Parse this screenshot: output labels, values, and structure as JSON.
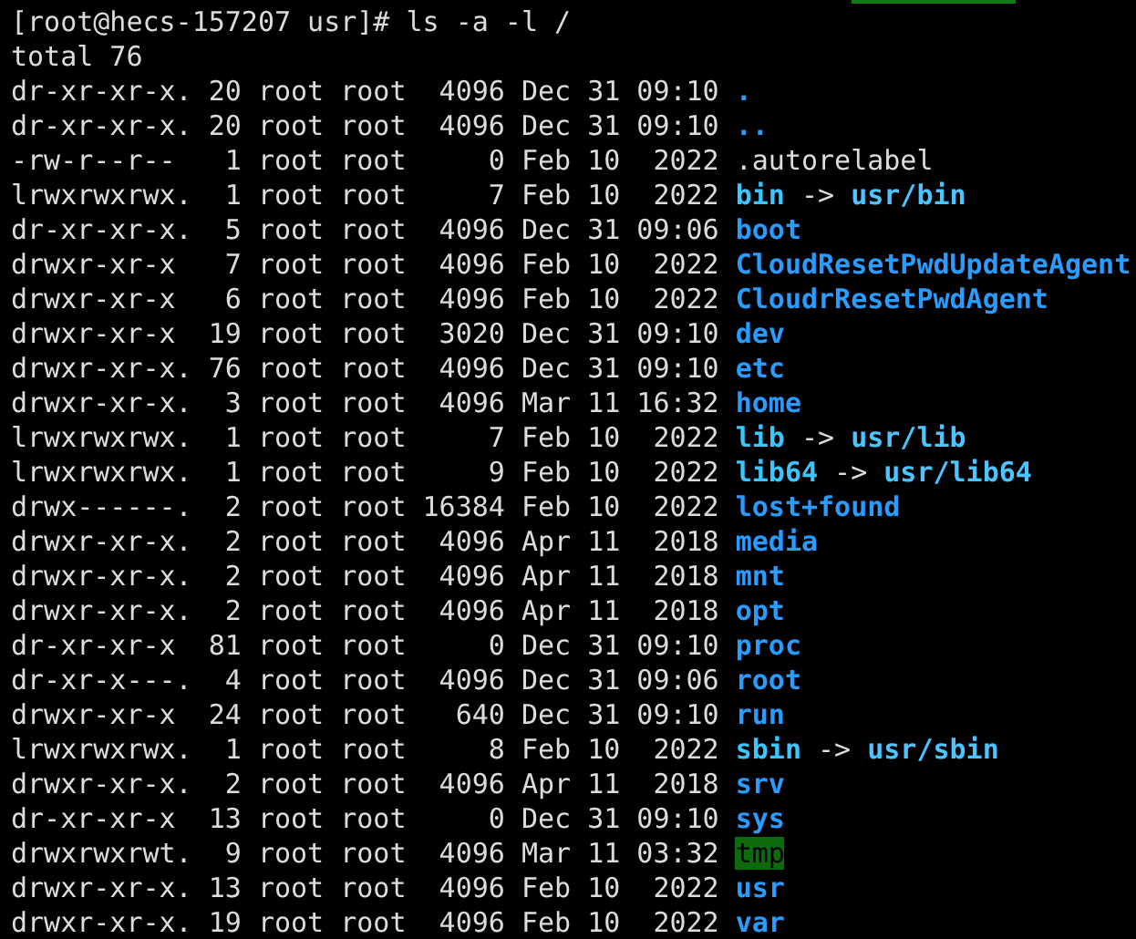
{
  "prompt": "[root@hecs-157207 usr]# ls -a -l /",
  "total": "total 76",
  "entries": [
    {
      "details": "dr-xr-xr-x. 20 root root  4096 Dec 31 09:10",
      "name": ".",
      "kind": "dir"
    },
    {
      "details": "dr-xr-xr-x. 20 root root  4096 Dec 31 09:10",
      "name": "..",
      "kind": "dir"
    },
    {
      "details": "-rw-r--r--   1 root root     0 Feb 10  2022",
      "name": ".autorelabel",
      "kind": "file"
    },
    {
      "details": "lrwxrwxrwx.  1 root root     7 Feb 10  2022",
      "name": "bin",
      "kind": "link",
      "arrow": "->",
      "target": "usr/bin"
    },
    {
      "details": "dr-xr-xr-x.  5 root root  4096 Dec 31 09:06",
      "name": "boot",
      "kind": "dir"
    },
    {
      "details": "drwxr-xr-x   7 root root  4096 Feb 10  2022",
      "name": "CloudResetPwdUpdateAgent",
      "kind": "dir"
    },
    {
      "details": "drwxr-xr-x   6 root root  4096 Feb 10  2022",
      "name": "CloudrResetPwdAgent",
      "kind": "dir"
    },
    {
      "details": "drwxr-xr-x  19 root root  3020 Dec 31 09:10",
      "name": "dev",
      "kind": "dir"
    },
    {
      "details": "drwxr-xr-x. 76 root root  4096 Dec 31 09:10",
      "name": "etc",
      "kind": "dir"
    },
    {
      "details": "drwxr-xr-x.  3 root root  4096 Mar 11 16:32",
      "name": "home",
      "kind": "dir"
    },
    {
      "details": "lrwxrwxrwx.  1 root root     7 Feb 10  2022",
      "name": "lib",
      "kind": "link",
      "arrow": "->",
      "target": "usr/lib"
    },
    {
      "details": "lrwxrwxrwx.  1 root root     9 Feb 10  2022",
      "name": "lib64",
      "kind": "link",
      "arrow": "->",
      "target": "usr/lib64"
    },
    {
      "details": "drwx------.  2 root root 16384 Feb 10  2022",
      "name": "lost+found",
      "kind": "dir"
    },
    {
      "details": "drwxr-xr-x.  2 root root  4096 Apr 11  2018",
      "name": "media",
      "kind": "dir"
    },
    {
      "details": "drwxr-xr-x.  2 root root  4096 Apr 11  2018",
      "name": "mnt",
      "kind": "dir"
    },
    {
      "details": "drwxr-xr-x.  2 root root  4096 Apr 11  2018",
      "name": "opt",
      "kind": "dir"
    },
    {
      "details": "dr-xr-xr-x  81 root root     0 Dec 31 09:10",
      "name": "proc",
      "kind": "dir"
    },
    {
      "details": "dr-xr-x---.  4 root root  4096 Dec 31 09:06",
      "name": "root",
      "kind": "dir"
    },
    {
      "details": "drwxr-xr-x  24 root root   640 Dec 31 09:10",
      "name": "run",
      "kind": "dir"
    },
    {
      "details": "lrwxrwxrwx.  1 root root     8 Feb 10  2022",
      "name": "sbin",
      "kind": "link",
      "arrow": "->",
      "target": "usr/sbin"
    },
    {
      "details": "drwxr-xr-x.  2 root root  4096 Apr 11  2018",
      "name": "srv",
      "kind": "dir"
    },
    {
      "details": "dr-xr-xr-x  13 root root     0 Dec 31 09:10",
      "name": "sys",
      "kind": "dir"
    },
    {
      "details": "drwxrwxrwt.  9 root root  4096 Mar 11 03:32",
      "name": "tmp",
      "kind": "sticky"
    },
    {
      "details": "drwxr-xr-x. 13 root root  4096 Feb 10  2022",
      "name": "usr",
      "kind": "dir"
    },
    {
      "details": "drwxr-xr-x. 19 root root  4096 Feb 10  2022",
      "name": "var",
      "kind": "dir"
    }
  ]
}
